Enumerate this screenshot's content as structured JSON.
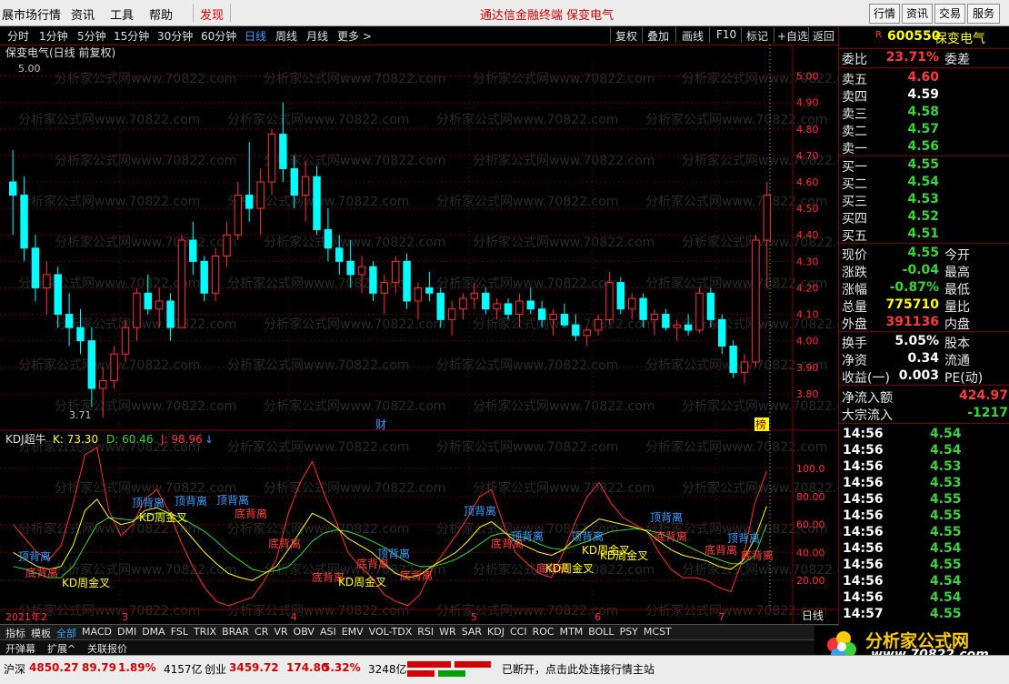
{
  "menu": {
    "items": [
      "展市场行情",
      "资讯",
      "工具",
      "帮助"
    ],
    "discover": "发现",
    "title": "通达信金融终端  保变电气",
    "right_buttons": [
      "行情",
      "资讯",
      "交易",
      "服务"
    ]
  },
  "periods": {
    "items": [
      "分时",
      "1分钟",
      "5分钟",
      "15分钟",
      "30分钟",
      "60分钟",
      "日线",
      "周线",
      "月线",
      "更多 >"
    ],
    "active": "日线",
    "tools": [
      "复权",
      "叠加",
      "画线",
      "F10",
      "标记",
      "+自选",
      "返回"
    ]
  },
  "chart": {
    "title": "保变电气(日线 前复权)",
    "high_label": "5.00",
    "low_label": "3.71",
    "price_ticks": [
      "5.00",
      "4.90",
      "4.80",
      "4.70",
      "4.60",
      "4.50",
      "4.40",
      "4.30",
      "4.20",
      "4.10",
      "4.00",
      "3.90",
      "3.80"
    ],
    "event_marks": [
      "财",
      "榜"
    ],
    "watermark": "分析家公式网www.70822.com",
    "kdj_title": "KDJ超牛",
    "kdj_k": "K: 73.30",
    "kdj_d": "D: 60.46",
    "kdj_j": "J: 98.96",
    "kdj_ticks": [
      "100.0",
      "80.00",
      "60.00",
      "40.00",
      "20.00"
    ],
    "x_labels": [
      "2021年2",
      "3",
      "4",
      "5",
      "6",
      "7"
    ],
    "period_label": "日线",
    "annotations": [
      {
        "text": "顶背离",
        "color": "#3aa0ff"
      },
      {
        "text": "底背离",
        "color": "#ff4040"
      },
      {
        "text": "KD周金叉",
        "color": "#ffff00"
      }
    ],
    "colors": {
      "up": "#ff3030",
      "down": "#00ffff",
      "k": "#ffffff",
      "d": "#ffff00",
      "j": "#ff3030",
      "grid": "#5a0000"
    }
  },
  "chart_data": {
    "type": "candlestick",
    "symbol": "600550",
    "candles": [
      [
        4.6,
        4.72,
        4.4,
        4.55
      ],
      [
        4.55,
        4.62,
        4.3,
        4.35
      ],
      [
        4.35,
        4.4,
        4.15,
        4.2
      ],
      [
        4.2,
        4.3,
        4.1,
        4.25
      ],
      [
        4.25,
        4.28,
        4.05,
        4.1
      ],
      [
        4.1,
        4.18,
        3.98,
        4.05
      ],
      [
        4.05,
        4.12,
        3.95,
        4.0
      ],
      [
        4.0,
        4.05,
        3.75,
        3.82
      ],
      [
        3.82,
        3.9,
        3.71,
        3.85
      ],
      [
        3.85,
        3.98,
        3.82,
        3.95
      ],
      [
        3.95,
        4.08,
        3.92,
        4.05
      ],
      [
        4.05,
        4.2,
        4.0,
        4.18
      ],
      [
        4.18,
        4.25,
        4.1,
        4.12
      ],
      [
        4.12,
        4.2,
        4.05,
        4.15
      ],
      [
        4.15,
        4.18,
        4.0,
        4.05
      ],
      [
        4.05,
        4.4,
        4.05,
        4.38
      ],
      [
        4.38,
        4.45,
        4.25,
        4.3
      ],
      [
        4.3,
        4.32,
        4.15,
        4.18
      ],
      [
        4.18,
        4.35,
        4.15,
        4.32
      ],
      [
        4.32,
        4.45,
        4.28,
        4.4
      ],
      [
        4.4,
        4.6,
        4.38,
        4.55
      ],
      [
        4.55,
        4.75,
        4.45,
        4.5
      ],
      [
        4.5,
        4.65,
        4.4,
        4.6
      ],
      [
        4.6,
        4.8,
        4.55,
        4.78
      ],
      [
        4.78,
        4.9,
        4.6,
        4.65
      ],
      [
        4.65,
        4.7,
        4.5,
        4.55
      ],
      [
        4.55,
        4.68,
        4.45,
        4.62
      ],
      [
        4.62,
        4.66,
        4.4,
        4.42
      ],
      [
        4.42,
        4.5,
        4.3,
        4.35
      ],
      [
        4.35,
        4.4,
        4.25,
        4.3
      ],
      [
        4.3,
        4.38,
        4.2,
        4.25
      ],
      [
        4.25,
        4.32,
        4.18,
        4.28
      ],
      [
        4.28,
        4.3,
        4.15,
        4.18
      ],
      [
        4.18,
        4.25,
        4.1,
        4.22
      ],
      [
        4.22,
        4.32,
        4.18,
        4.3
      ],
      [
        4.3,
        4.33,
        4.12,
        4.15
      ],
      [
        4.15,
        4.22,
        4.08,
        4.2
      ],
      [
        4.2,
        4.26,
        4.15,
        4.18
      ],
      [
        4.18,
        4.2,
        4.05,
        4.08
      ],
      [
        4.08,
        4.15,
        4.02,
        4.12
      ],
      [
        4.12,
        4.18,
        4.08,
        4.16
      ],
      [
        4.16,
        4.22,
        4.12,
        4.18
      ],
      [
        4.18,
        4.2,
        4.1,
        4.12
      ],
      [
        4.12,
        4.16,
        4.08,
        4.14
      ],
      [
        4.14,
        4.16,
        4.08,
        4.1
      ],
      [
        4.1,
        4.18,
        4.05,
        4.15
      ],
      [
        4.15,
        4.2,
        4.1,
        4.12
      ],
      [
        4.12,
        4.15,
        4.05,
        4.08
      ],
      [
        4.08,
        4.12,
        4.02,
        4.1
      ],
      [
        4.1,
        4.14,
        4.05,
        4.06
      ],
      [
        4.06,
        4.1,
        4.0,
        4.02
      ],
      [
        4.02,
        4.05,
        3.98,
        4.04
      ],
      [
        4.04,
        4.1,
        4.02,
        4.08
      ],
      [
        4.08,
        4.26,
        4.06,
        4.22
      ],
      [
        4.22,
        4.24,
        4.1,
        4.12
      ],
      [
        4.12,
        4.18,
        4.08,
        4.16
      ],
      [
        4.16,
        4.18,
        4.05,
        4.08
      ],
      [
        4.08,
        4.12,
        4.02,
        4.1
      ],
      [
        4.1,
        4.12,
        4.04,
        4.05
      ],
      [
        4.05,
        4.08,
        4.0,
        4.06
      ],
      [
        4.06,
        4.1,
        4.02,
        4.04
      ],
      [
        4.04,
        4.2,
        4.03,
        4.18
      ],
      [
        4.18,
        4.2,
        4.05,
        4.08
      ],
      [
        4.08,
        4.1,
        3.95,
        3.98
      ],
      [
        3.98,
        4.0,
        3.86,
        3.88
      ],
      [
        3.88,
        3.95,
        3.84,
        3.92
      ],
      [
        3.92,
        4.4,
        3.9,
        4.38
      ],
      [
        4.38,
        4.6,
        4.2,
        4.55
      ]
    ],
    "kdj": {
      "k": [
        40,
        35,
        30,
        28,
        30,
        45,
        70,
        78,
        65,
        60,
        62,
        70,
        72,
        68,
        60,
        50,
        40,
        32,
        25,
        22,
        20,
        25,
        30,
        42,
        55,
        68,
        64,
        58,
        50,
        45,
        40,
        32,
        25,
        22,
        24,
        30,
        35,
        40,
        48,
        58,
        62,
        55,
        48,
        44,
        40,
        38,
        42,
        50,
        58,
        64,
        62,
        60,
        58,
        55,
        48,
        42,
        38,
        36,
        34,
        30,
        28,
        34,
        50,
        73
      ],
      "d": [
        30,
        28,
        25,
        22,
        22,
        30,
        45,
        60,
        65,
        64,
        63,
        66,
        68,
        68,
        65,
        60,
        55,
        48,
        40,
        34,
        28,
        26,
        27,
        30,
        38,
        48,
        54,
        56,
        55,
        52,
        48,
        44,
        38,
        33,
        30,
        30,
        32,
        35,
        40,
        46,
        52,
        54,
        52,
        50,
        46,
        43,
        42,
        45,
        48,
        52,
        55,
        56,
        57,
        56,
        54,
        50,
        46,
        42,
        38,
        35,
        32,
        32,
        38,
        60
      ],
      "j": [
        60,
        50,
        40,
        35,
        45,
        75,
        110,
        115,
        70,
        52,
        60,
        78,
        85,
        70,
        48,
        30,
        15,
        5,
        2,
        5,
        8,
        20,
        35,
        68,
        90,
        105,
        82,
        62,
        40,
        30,
        22,
        10,
        5,
        2,
        10,
        28,
        40,
        52,
        65,
        80,
        85,
        60,
        40,
        32,
        25,
        22,
        40,
        62,
        80,
        90,
        75,
        65,
        60,
        55,
        40,
        28,
        22,
        22,
        20,
        15,
        12,
        35,
        75,
        98
      ]
    },
    "ylim": [
      3.7,
      5.05
    ],
    "kdj_ylim": [
      0,
      115
    ]
  },
  "quote": {
    "code": "600550",
    "name": "保变电气",
    "wb_label": "委比",
    "wb_value": "23.71%",
    "wc_label": "委差",
    "asks": [
      {
        "l": "卖五",
        "p": "4.60"
      },
      {
        "l": "卖四",
        "p": "4.59"
      },
      {
        "l": "卖三",
        "p": "4.58"
      },
      {
        "l": "卖二",
        "p": "4.57"
      },
      {
        "l": "卖一",
        "p": "4.56"
      }
    ],
    "bids": [
      {
        "l": "买一",
        "p": "4.55"
      },
      {
        "l": "买二",
        "p": "4.54"
      },
      {
        "l": "买三",
        "p": "4.53"
      },
      {
        "l": "买四",
        "p": "4.52"
      },
      {
        "l": "买五",
        "p": "4.51"
      }
    ],
    "stats": [
      {
        "l": "现价",
        "v": "4.55",
        "r": "今开",
        "c": "green"
      },
      {
        "l": "涨跌",
        "v": "-0.04",
        "r": "最高",
        "c": "green"
      },
      {
        "l": "涨幅",
        "v": "-0.87%",
        "r": "最低",
        "c": "green"
      },
      {
        "l": "总量",
        "v": "775710",
        "r": "量比",
        "c": "yellow"
      },
      {
        "l": "外盘",
        "v": "391136",
        "r": "内盘",
        "c": "red"
      }
    ],
    "stats2": [
      {
        "l": "换手",
        "v": "5.05%",
        "r": "股本",
        "c": "white"
      },
      {
        "l": "净资",
        "v": "0.34",
        "r": "流通",
        "c": "white"
      },
      {
        "l": "收益(一)",
        "v": "0.003",
        "r": "PE(动)",
        "c": "white"
      }
    ],
    "flow": [
      {
        "l": "净流入额",
        "v": "424.97",
        "c": "red"
      },
      {
        "l": "大宗流入",
        "v": "-1217",
        "c": "green"
      }
    ],
    "ticks": [
      {
        "t": "14:56",
        "p": "4.54"
      },
      {
        "t": "14:56",
        "p": "4.54"
      },
      {
        "t": "14:56",
        "p": "4.53"
      },
      {
        "t": "14:56",
        "p": "4.53"
      },
      {
        "t": "14:56",
        "p": "4.55"
      },
      {
        "t": "14:56",
        "p": "4.55"
      },
      {
        "t": "14:56",
        "p": "4.55"
      },
      {
        "t": "14:56",
        "p": "4.54"
      },
      {
        "t": "14:56",
        "p": "4.55"
      },
      {
        "t": "14:56",
        "p": "4.54"
      },
      {
        "t": "14:56",
        "p": "4.54"
      },
      {
        "t": "14:57",
        "p": "4.55"
      }
    ]
  },
  "tabs": {
    "items": [
      "指标",
      "模板",
      "全部",
      "MACD",
      "DMI",
      "DMA",
      "FSL",
      "TRIX",
      "BRAR",
      "CR",
      "VR",
      "OBV",
      "ASI",
      "EMV",
      "VOL-TDX",
      "RSI",
      "WR",
      "SAR",
      "KDJ",
      "CCI",
      "ROC",
      "MTM",
      "BOLL",
      "PSY",
      "MCST"
    ],
    "active": "全部",
    "row2": [
      "开弹幕",
      "扩展^",
      "关联报价"
    ]
  },
  "status": {
    "sh_label": "沪深",
    "sh_val": "4850.27",
    "sh_chg": "89.79",
    "sh_pct": "1.89%",
    "sh_amt": "4157亿",
    "cy_label": "创业",
    "cy_val": "3459.72",
    "cy_chg": "174.80",
    "cy_pct": "5.32%",
    "cy_amt": "3248亿",
    "msg": "已断开，点击此处连接行情主站"
  },
  "logo": {
    "text": "分析家公式网",
    "url": "www.70822.com"
  }
}
